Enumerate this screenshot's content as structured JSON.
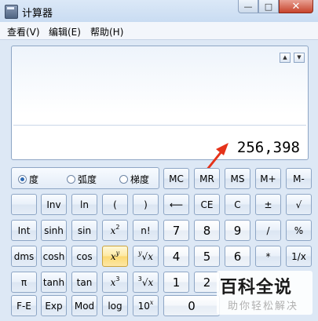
{
  "window": {
    "title": "计算器",
    "min": "—",
    "max": "□",
    "close": "✕"
  },
  "menu": [
    "查看(V)",
    "编辑(E)",
    "帮助(H)"
  ],
  "display": {
    "value": "256,398",
    "scroll_up": "▲",
    "scroll_down": "▼"
  },
  "angle_modes": [
    {
      "label": "度",
      "selected": true
    },
    {
      "label": "弧度",
      "selected": false
    },
    {
      "label": "梯度",
      "selected": false
    }
  ],
  "keys": {
    "mc": "MC",
    "mr": "MR",
    "ms": "MS",
    "mplus": "M+",
    "mminus": "M-",
    "inv": "Inv",
    "ln": "ln",
    "lparen": "(",
    "rparen": ")",
    "back": "⟵",
    "ce": "CE",
    "c": "C",
    "neg": "±",
    "sqrt": "√",
    "int": "Int",
    "sinh": "sinh",
    "sin": "sin",
    "x2_base": "x",
    "x2_exp": "2",
    "fact": "n!",
    "n7": "7",
    "n8": "8",
    "n9": "9",
    "div": "/",
    "pct": "%",
    "dms": "dms",
    "cosh": "cosh",
    "cos": "cos",
    "xy_base": "x",
    "xy_exp": "y",
    "yroot_idx": "y",
    "yroot_x": "x",
    "n4": "4",
    "n5": "5",
    "n6": "6",
    "mul": "*",
    "recip": "1/x",
    "pi": "π",
    "tanh": "tanh",
    "tan": "tan",
    "x3_base": "x",
    "x3_exp": "3",
    "root3_idx": "3",
    "root3_x": "x",
    "n1": "1",
    "n2": "2",
    "fe": "F-E",
    "exp": "Exp",
    "mod": "Mod",
    "log": "log",
    "tenx_base": "10",
    "tenx_exp": "x",
    "n0": "0"
  },
  "watermark": {
    "main": "百科全说",
    "sub": "助你轻松解决"
  },
  "colors": {
    "arrow": "#e5331a",
    "selected_radio": "#2e6ab3",
    "highlight_key": "#fbd972"
  }
}
